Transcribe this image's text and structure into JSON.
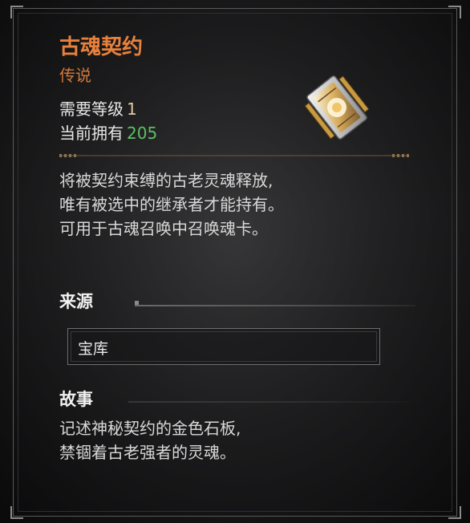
{
  "item": {
    "name": "古魂契约",
    "rarity": "传说",
    "level_label": "需要等级",
    "level_value": "1",
    "owned_label": "当前拥有",
    "owned_value": "205",
    "icon": "golden-stone-tablet-icon",
    "description": [
      "将被契约束缚的古老灵魂释放,",
      "唯有被选中的继承者才能持有。",
      "可用于古魂召唤中召唤魂卡。"
    ]
  },
  "source": {
    "heading": "来源",
    "entry": "宝库"
  },
  "story": {
    "heading": "故事",
    "lines": [
      "记述神秘契约的金色石板,",
      "禁锢着古老强者的灵魂。"
    ]
  },
  "colors": {
    "title": "#e8813c",
    "rarity": "#d4793a",
    "owned_value": "#5cc063",
    "frame": "#5a5a5a"
  }
}
